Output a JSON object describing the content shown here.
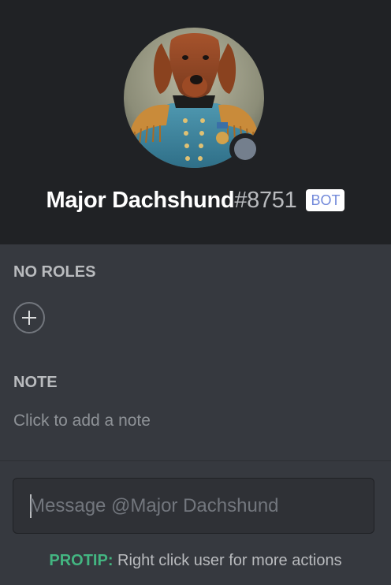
{
  "profile": {
    "username": "Major Dachshund",
    "discriminator": "#8751",
    "tag": "BOT",
    "status": "offline",
    "avatar": "dachshund-general-portrait"
  },
  "roles": {
    "title": "NO ROLES",
    "add_icon": "plus-icon"
  },
  "note": {
    "title": "NOTE",
    "placeholder": "Click to add a note"
  },
  "message": {
    "placeholder": "Message @Major Dachshund",
    "value": ""
  },
  "protip": {
    "label": "PROTIP:",
    "text": " Right click user for more actions"
  },
  "colors": {
    "background": "#36393f",
    "header": "#202225",
    "accent_bot": "#7289da",
    "protip_green": "#43b581",
    "status_offline": "#747f8d"
  }
}
